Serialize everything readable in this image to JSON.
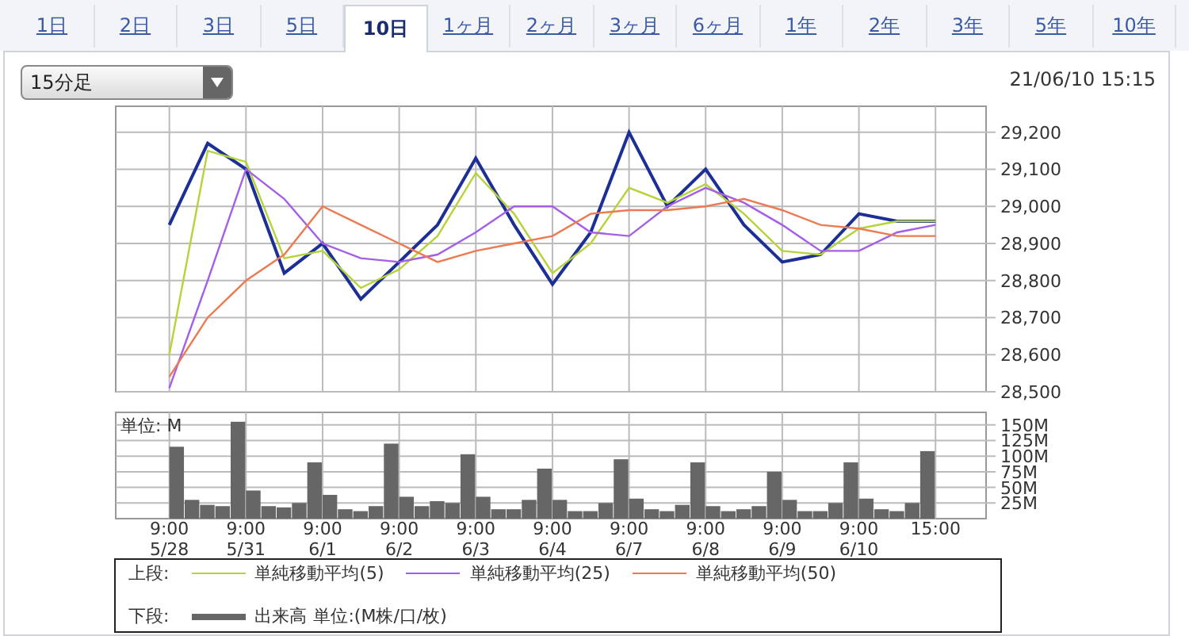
{
  "tabs": [
    {
      "label": "1日",
      "selected": false
    },
    {
      "label": "2日",
      "selected": false
    },
    {
      "label": "3日",
      "selected": false
    },
    {
      "label": "5日",
      "selected": false
    },
    {
      "label": "10日",
      "selected": true
    },
    {
      "label": "1ヶ月",
      "selected": false
    },
    {
      "label": "2ヶ月",
      "selected": false
    },
    {
      "label": "3ヶ月",
      "selected": false
    },
    {
      "label": "6ヶ月",
      "selected": false
    },
    {
      "label": "1年",
      "selected": false
    },
    {
      "label": "2年",
      "selected": false
    },
    {
      "label": "3年",
      "selected": false
    },
    {
      "label": "5年",
      "selected": false
    },
    {
      "label": "10年",
      "selected": false
    }
  ],
  "interval_select": {
    "value": "15分足"
  },
  "timestamp": "21/06/10 15:15",
  "price_chart": {
    "chart_data": {
      "type": "line",
      "grid": true,
      "categories": [
        null,
        null,
        null,
        null,
        null,
        null,
        null,
        null,
        null,
        null,
        null,
        null,
        null,
        null,
        null,
        null,
        null,
        null,
        null,
        null,
        null
      ],
      "ylim": [
        28500,
        29270
      ],
      "yticks": [
        {
          "value": 28500,
          "label": "28,500"
        },
        {
          "value": 28600,
          "label": "28,600"
        },
        {
          "value": 28700,
          "label": "28,700"
        },
        {
          "value": 28800,
          "label": "28,800"
        },
        {
          "value": 28900,
          "label": "28,900"
        },
        {
          "value": 29000,
          "label": "29,000"
        },
        {
          "value": 29100,
          "label": "29,100"
        },
        {
          "value": 29200,
          "label": "29,200"
        }
      ],
      "series": [
        {
          "color": "#1c2f95",
          "values": [
            28950,
            29170,
            29100,
            28820,
            28900,
            28750,
            28850,
            28950,
            29130,
            28950,
            28790,
            28930,
            29200,
            29000,
            29100,
            28950,
            28850,
            28870,
            28980,
            28960,
            28960
          ]
        },
        {
          "name": "単純移動平均(5)",
          "color": "#b5d33a",
          "values": [
            28600,
            29150,
            29120,
            28860,
            28880,
            28780,
            28830,
            28920,
            29090,
            28980,
            28820,
            28900,
            29050,
            29010,
            29060,
            28980,
            28880,
            28870,
            28940,
            28960,
            28960
          ]
        },
        {
          "name": "単純移動平均(25)",
          "color": "#a45ee8",
          "values": [
            28510,
            28800,
            29100,
            29020,
            28900,
            28860,
            28850,
            28870,
            28930,
            29000,
            29000,
            28930,
            28920,
            29000,
            29050,
            29010,
            28950,
            28880,
            28880,
            28930,
            28950
          ]
        },
        {
          "name": "単純移動平均(50)",
          "color": "#ec7a52",
          "values": [
            28540,
            28700,
            28800,
            28870,
            29000,
            28950,
            28900,
            28850,
            28880,
            28900,
            28920,
            28980,
            28990,
            28990,
            29000,
            29020,
            28990,
            28950,
            28940,
            28920,
            28920
          ]
        }
      ]
    }
  },
  "volume_chart": {
    "unit_label": "単位: M",
    "chart_data": {
      "type": "bar",
      "grid": true,
      "ylim": [
        0,
        170
      ],
      "yticks": [
        {
          "value": 25,
          "label": "25M"
        },
        {
          "value": 50,
          "label": "50M"
        },
        {
          "value": 75,
          "label": "75M"
        },
        {
          "value": 100,
          "label": "100M"
        },
        {
          "value": 125,
          "label": "125M"
        },
        {
          "value": 150,
          "label": "150M"
        }
      ],
      "categories": [
        "9:00\n5/28",
        null,
        null,
        null,
        null,
        "9:00\n5/31",
        null,
        null,
        null,
        null,
        "9:00\n6/1",
        null,
        null,
        null,
        null,
        "9:00\n6/2",
        null,
        null,
        null,
        null,
        "9:00\n6/3",
        null,
        null,
        null,
        null,
        "9:00\n6/4",
        null,
        null,
        null,
        null,
        "9:00\n6/7",
        null,
        null,
        null,
        null,
        "9:00\n6/8",
        null,
        null,
        null,
        null,
        "9:00\n6/9",
        null,
        null,
        null,
        null,
        "9:00\n6/10",
        null,
        null,
        null,
        null,
        "15:00"
      ],
      "series": [
        {
          "name": "出来高",
          "color": "#666666",
          "values": [
            115,
            30,
            22,
            20,
            155,
            45,
            20,
            18,
            25,
            90,
            38,
            15,
            12,
            20,
            120,
            35,
            20,
            28,
            25,
            103,
            35,
            15,
            15,
            30,
            80,
            30,
            12,
            12,
            25,
            95,
            32,
            15,
            12,
            22,
            90,
            20,
            12,
            15,
            20,
            75,
            30,
            12,
            12,
            25,
            90,
            32,
            15,
            12,
            25,
            108,
            null
          ]
        }
      ]
    }
  },
  "legend": {
    "upper_label": "上段:",
    "lower_label": "下段:",
    "lower_unit": "単位:(M株/口/枚)"
  }
}
